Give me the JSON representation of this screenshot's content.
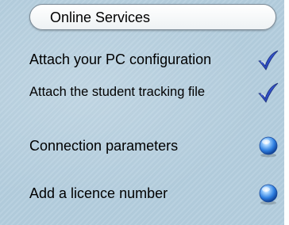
{
  "header": {
    "title": "Online Services"
  },
  "items": [
    {
      "label": "Attach your PC configuration",
      "icon": "checkmark-icon"
    },
    {
      "label": "Attach the student tracking file",
      "icon": "checkmark-icon"
    },
    {
      "label": "Connection parameters",
      "icon": "blue-orb-icon"
    },
    {
      "label": "Add a licence number",
      "icon": "blue-orb-icon"
    }
  ],
  "colors": {
    "panel_background": "#b4cede",
    "check_color": "#2f4fc9",
    "orb_color": "#2f7fe0"
  }
}
